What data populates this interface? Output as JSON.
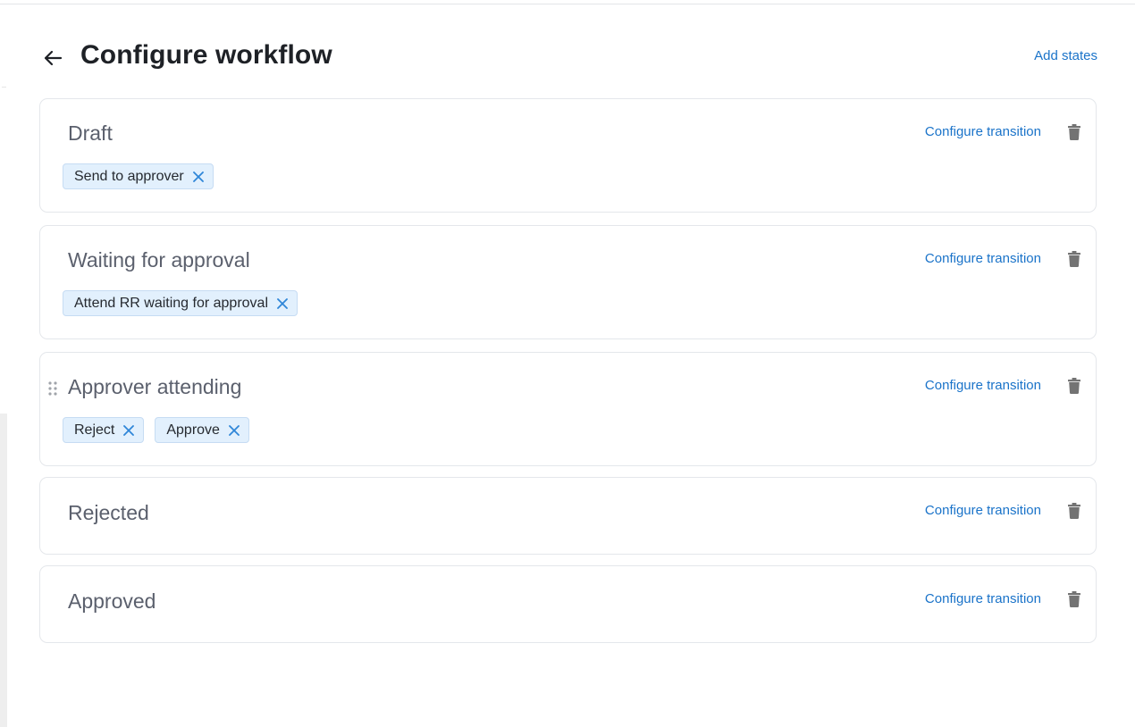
{
  "header": {
    "back_icon": "arrow-left-icon",
    "title": "Configure workflow",
    "add_states_label": "Add states"
  },
  "colors": {
    "accent": "#1a73c9",
    "chip_bg": "#e2f0fd",
    "chip_close": "#2f86d8",
    "state_name": "#5b606d",
    "trash": "#737373"
  },
  "states": [
    {
      "name": "Draft",
      "configure_label": "Configure transition",
      "delete_icon": "trash-icon",
      "transitions": [
        {
          "label": "Send to approver",
          "close_icon": "close-icon"
        }
      ]
    },
    {
      "name": "Waiting for approval",
      "configure_label": "Configure transition",
      "delete_icon": "trash-icon",
      "transitions": [
        {
          "label": "Attend RR waiting for approval",
          "close_icon": "close-icon"
        }
      ]
    },
    {
      "name": "Approver attending",
      "configure_label": "Configure transition",
      "delete_icon": "trash-icon",
      "drag_icon": "drag-handle-icon",
      "transitions": [
        {
          "label": "Reject",
          "close_icon": "close-icon"
        },
        {
          "label": "Approve",
          "close_icon": "close-icon"
        }
      ]
    },
    {
      "name": "Rejected",
      "configure_label": "Configure transition",
      "delete_icon": "trash-icon",
      "transitions": []
    },
    {
      "name": "Approved",
      "configure_label": "Configure transition",
      "delete_icon": "trash-icon",
      "transitions": []
    }
  ]
}
